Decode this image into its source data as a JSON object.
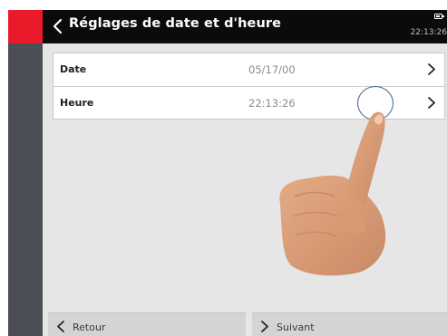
{
  "header": {
    "title": "Réglages de date et d'heure",
    "clock": "22:13:26",
    "back_icon": "chevron-left-icon",
    "battery_icon": "battery-icon",
    "accent_color": "#ea1a2a"
  },
  "settings": {
    "rows": [
      {
        "label": "Date",
        "value": "05/17/00",
        "icon": "chevron-right-icon"
      },
      {
        "label": "Heure",
        "value": "22:13:26",
        "icon": "chevron-right-icon"
      }
    ]
  },
  "footer": {
    "back_label": "Retour",
    "next_label": "Suivant"
  }
}
